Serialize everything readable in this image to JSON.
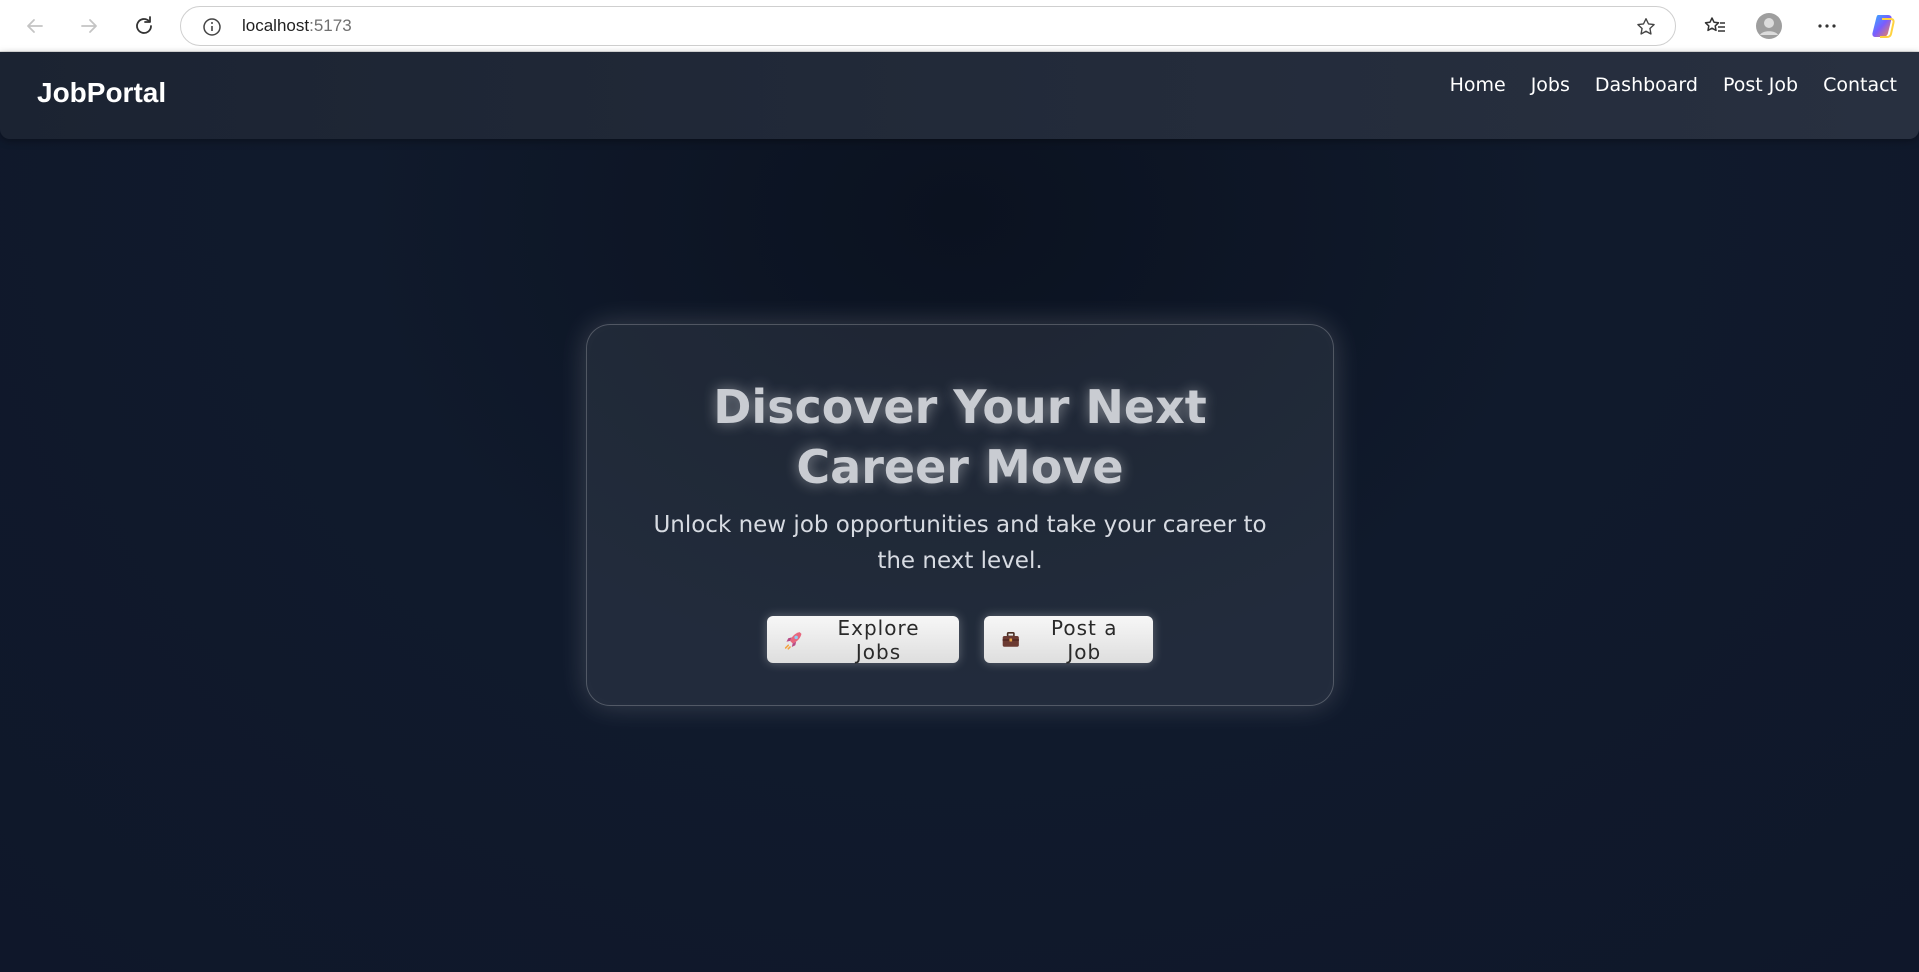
{
  "browser": {
    "url_host": "localhost",
    "url_port": ":5173"
  },
  "header": {
    "brand": "JobPortal",
    "nav": [
      "Home",
      "Jobs",
      "Dashboard",
      "Post Job",
      "Contact"
    ]
  },
  "hero": {
    "title": "Discover Your Next Career Move",
    "subtitle": "Unlock new job opportunities and take your career to the next level.",
    "explore_label": "Explore Jobs",
    "explore_icon": "rocket-icon",
    "post_label": "Post a Job",
    "post_icon": "briefcase-icon"
  },
  "colors": {
    "background": "#0f172a",
    "header_bg": "#222a39",
    "card_text": "#c9ccd2",
    "button_bg": "#f0f0f0"
  }
}
